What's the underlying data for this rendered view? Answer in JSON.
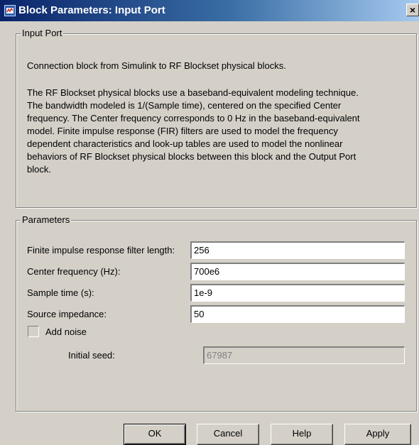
{
  "window": {
    "title": "Block Parameters: Input Port",
    "close_glyph": "×"
  },
  "description_group": {
    "legend": "Input Port",
    "line1": "Connection block from Simulink to RF Blockset physical blocks.",
    "lines": [
      "The RF Blockset physical blocks use a baseband-equivalent modeling technique.",
      "The bandwidth modeled is 1/(Sample time), centered on the specified Center",
      "frequency. The Center frequency corresponds to 0 Hz in the baseband-equivalent",
      "model. Finite impulse response (FIR) filters are used to model the frequency",
      "dependent characteristics and look-up tables are used to model the nonlinear",
      "behaviors of RF Blockset physical blocks between this block and the Output Port",
      "block."
    ]
  },
  "parameters_group": {
    "legend": "Parameters",
    "fir_length": {
      "label": "Finite impulse response filter length:",
      "value": "256"
    },
    "center_frequency": {
      "label": "Center frequency (Hz):",
      "value": "700e6"
    },
    "sample_time": {
      "label": "Sample time (s):",
      "value": "1e-9"
    },
    "source_impedance": {
      "label": "Source impedance:",
      "value": "50"
    },
    "add_noise": {
      "label": "Add noise",
      "checked": false
    },
    "initial_seed": {
      "label": "Initial seed:",
      "value": "67987",
      "enabled": false
    }
  },
  "buttons": {
    "ok": "OK",
    "cancel": "Cancel",
    "help": "Help",
    "apply": "Apply"
  },
  "colors": {
    "dialog_bg": "#d4d0c8",
    "titlebar_start": "#0a246a",
    "titlebar_end": "#a6caf0"
  }
}
